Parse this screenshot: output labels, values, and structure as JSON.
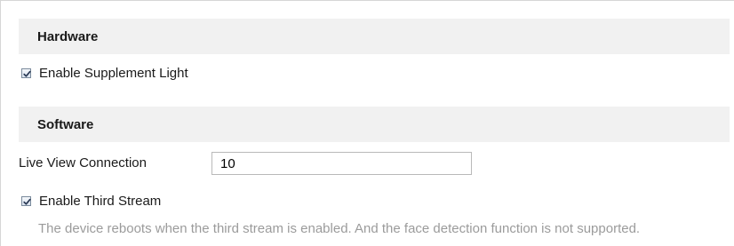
{
  "hardware": {
    "title": "Hardware",
    "supplement_light": {
      "label": "Enable Supplement Light",
      "checked": true
    }
  },
  "software": {
    "title": "Software",
    "live_view_connection": {
      "label": "Live View Connection",
      "value": "10"
    },
    "third_stream": {
      "label": "Enable Third Stream",
      "checked": true,
      "note": "The device reboots when the third stream is enabled. And the face detection function is not supported."
    }
  },
  "colors": {
    "section_header_bg": "#f1f1f1",
    "note_text": "#9b9b9b",
    "checkmark": "#2b3a55"
  },
  "icons": {
    "checkbox": "checkbox-checked-icon"
  }
}
